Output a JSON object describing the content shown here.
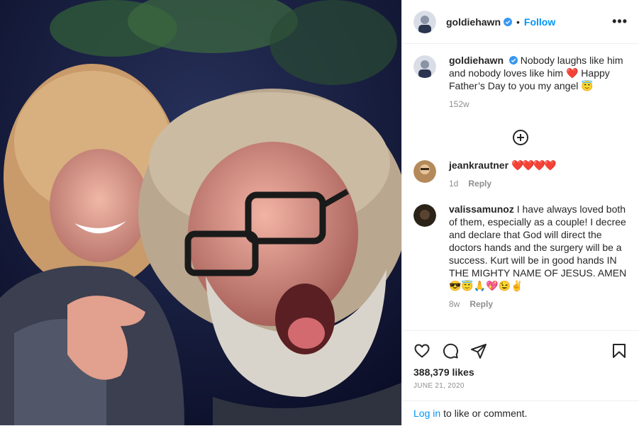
{
  "post": {
    "username": "goldiehawn",
    "follow_label": "Follow",
    "dot": "•",
    "more": "•••"
  },
  "caption": {
    "username": "goldiehawn",
    "text": "Nobody laughs like him and nobody loves like him ❤️ Happy Father’s Day to you my angel 😇",
    "time": "152w"
  },
  "comments": [
    {
      "username": "jeankrautner",
      "text": "❤️❤️❤️❤️",
      "time": "1d",
      "reply": "Reply"
    },
    {
      "username": "valissamunoz",
      "text": "I have always loved both of them, especially as a couple! I decree and declare that God will direct the doctors hands and the surgery will be a success. Kurt will be in good hands IN THE MIGHTY NAME OF JESUS. AMEN😎😇🙏💖😉✌️",
      "time": "8w",
      "reply": "Reply"
    }
  ],
  "stats": {
    "likes": "388,379 likes",
    "date": "JUNE 21, 2020"
  },
  "login": {
    "link": "Log in",
    "text": "to like or comment."
  },
  "colors": {
    "link_blue": "#0095f6",
    "muted": "#8e8e8e",
    "heart_red": "#e0245e"
  }
}
